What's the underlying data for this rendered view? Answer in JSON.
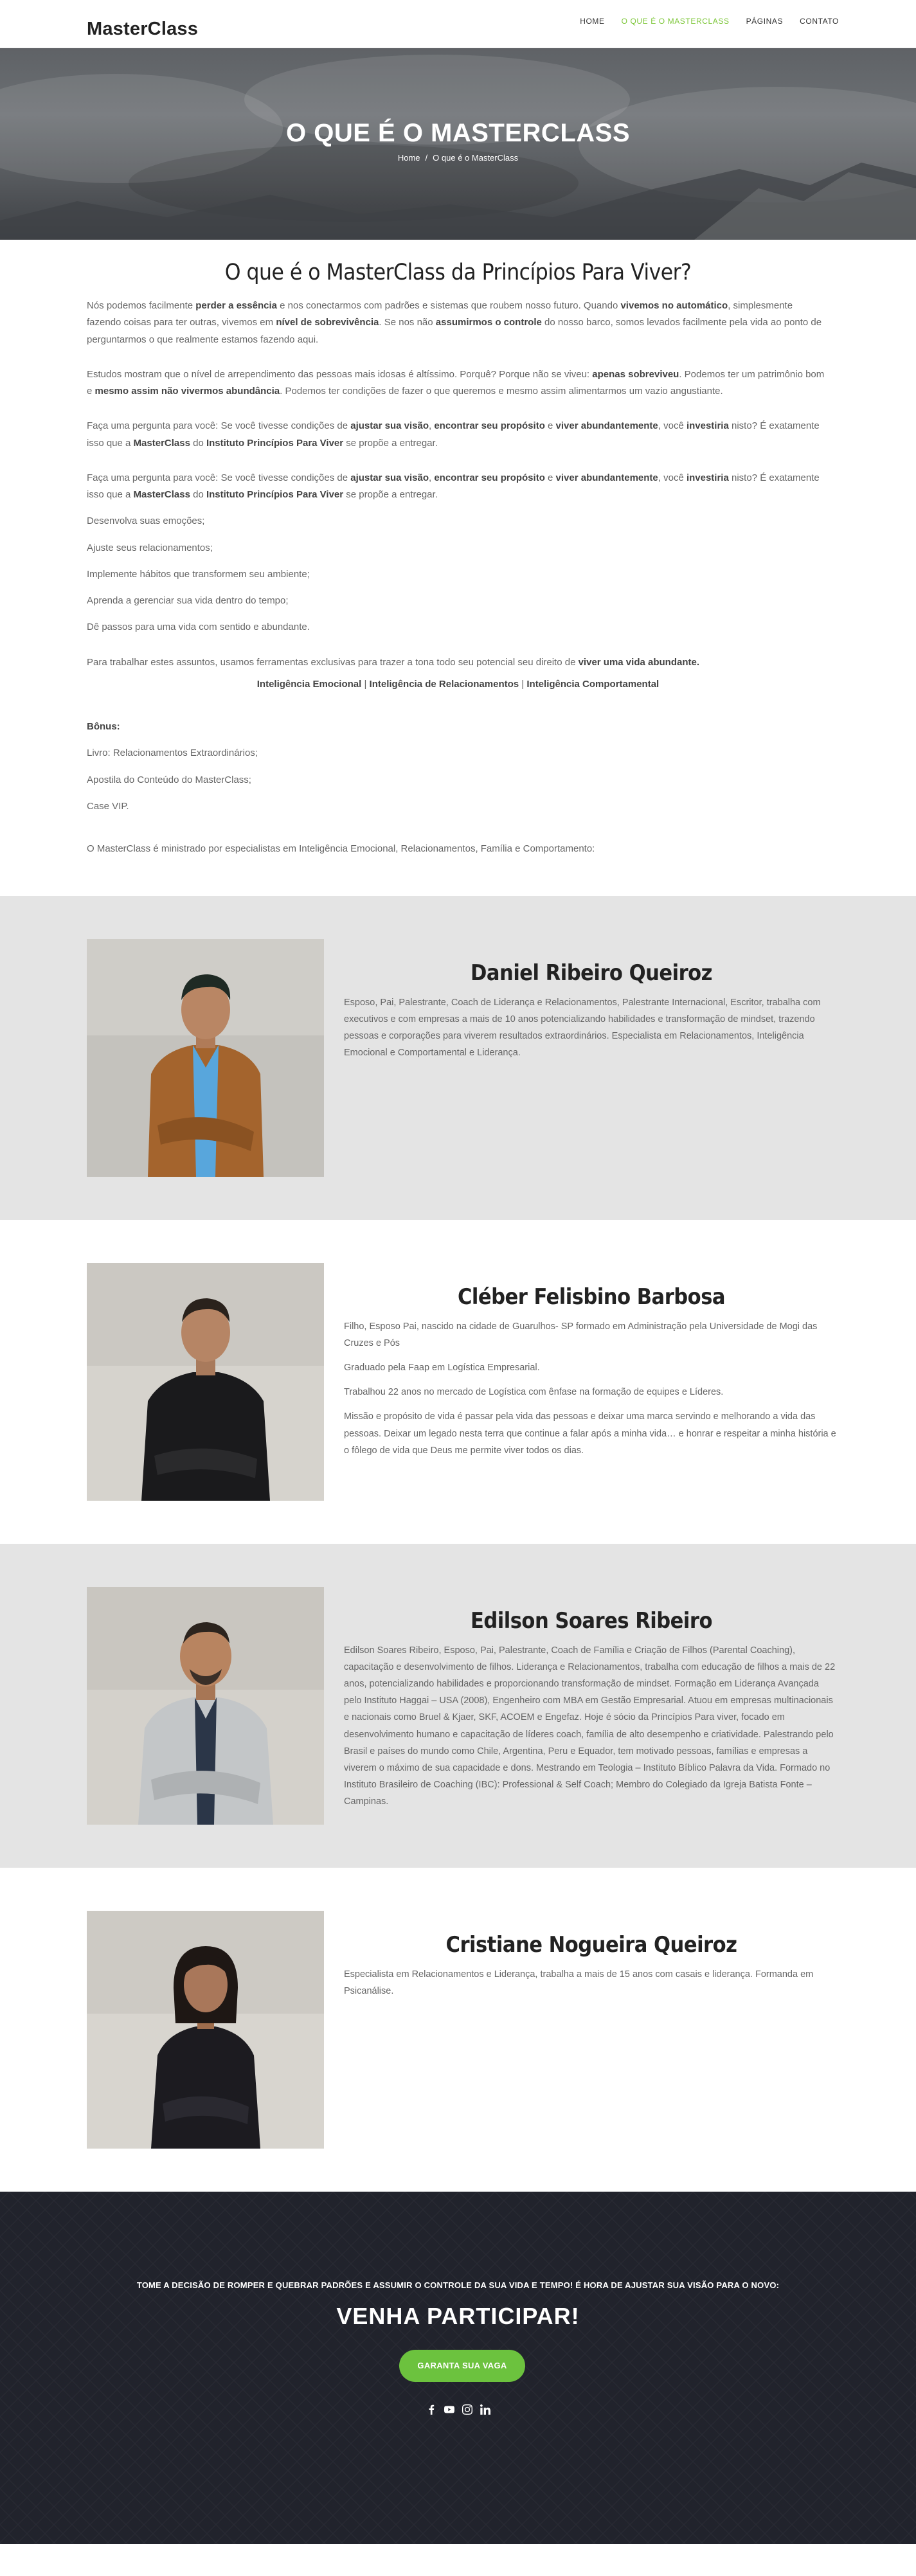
{
  "brand": {
    "logo": "MasterClass",
    "accent_color": "#7dc739",
    "button_color": "#6cc23e"
  },
  "nav": [
    {
      "label": "HOME",
      "active": false
    },
    {
      "label": "O QUE É O MASTERCLASS",
      "active": true
    },
    {
      "label": "PÁGINAS",
      "active": false
    },
    {
      "label": "CONTATO",
      "active": false
    }
  ],
  "hero": {
    "title": "O QUE É O MASTERCLASS",
    "breadcrumb_home": "Home",
    "breadcrumb_sep": "/",
    "breadcrumb_current": "O que é o MasterClass"
  },
  "intro": {
    "title": "O que é o MasterClass da Princípios Para Viver?",
    "p1": [
      {
        "t": "Nós podemos facilmente "
      },
      {
        "t": "perder a essência",
        "b": true
      },
      {
        "t": " e nos conectarmos com padrões e sistemas que roubem nosso futuro. Quando "
      },
      {
        "t": "vivemos no automático",
        "b": true
      },
      {
        "t": ", simplesmente fazendo coisas para ter outras, vivemos em "
      },
      {
        "t": "nível de sobrevivência",
        "b": true
      },
      {
        "t": ". Se nos não "
      },
      {
        "t": "assumirmos o controle",
        "b": true
      },
      {
        "t": " do nosso barco, somos levados facilmente pela vida ao ponto de perguntarmos o que realmente estamos fazendo aqui."
      }
    ],
    "p2": [
      {
        "t": "Estudos mostram que o nível de arrependimento das pessoas mais idosas é altíssimo. Porquê? Porque não se viveu: "
      },
      {
        "t": "apenas sobreviveu",
        "b": true
      },
      {
        "t": ". Podemos ter um patrimônio bom e "
      },
      {
        "t": "mesmo assim não vivermos abundância",
        "b": true
      },
      {
        "t": ". Podemos ter condições de fazer o que queremos e mesmo assim alimentarmos um vazio angustiante."
      }
    ],
    "p3": [
      {
        "t": "Faça uma pergunta para você: Se você tivesse condições de "
      },
      {
        "t": "ajustar sua visão",
        "b": true
      },
      {
        "t": ", "
      },
      {
        "t": "encontrar seu propósito",
        "b": true
      },
      {
        "t": " e "
      },
      {
        "t": "viver abundantemente",
        "b": true
      },
      {
        "t": ", você "
      },
      {
        "t": "investiria",
        "b": true
      },
      {
        "t": " nisto? É exatamente isso que a "
      },
      {
        "t": "MasterClass",
        "b": true
      },
      {
        "t": " do "
      },
      {
        "t": "Instituto Princípios Para Viver",
        "b": true
      },
      {
        "t": " se propõe a entregar."
      }
    ],
    "lines": [
      "Desenvolva suas emoções;",
      "Ajuste seus relacionamentos;",
      "Implemente hábitos que transformem seu ambiente;",
      "Aprenda a gerenciar sua vida dentro do tempo;",
      "Dê passos para uma vida com sentido e abundante."
    ],
    "p4": [
      {
        "t": "Para trabalhar estes assuntos, usamos ferramentas exclusivas para trazer a tona todo seu potencial seu direito de "
      },
      {
        "t": "viver uma vida abundante.",
        "b": true
      }
    ],
    "pillars": [
      {
        "t": "Inteligência Emocional",
        "b": true
      },
      {
        "t": " | "
      },
      {
        "t": "Inteligência de Relacionamentos",
        "b": true
      },
      {
        "t": " | "
      },
      {
        "t": "Inteligência Comportamental",
        "b": true
      }
    ],
    "bonus_title": "Bônus:",
    "bonus": [
      "Livro: Relacionamentos Extraordinários;",
      "Apostila do Conteúdo do MasterClass;",
      "Case VIP."
    ],
    "closing": "O MasterClass é ministrado por especialistas em Inteligência Emocional, Relacionamentos, Família e Comportamento:"
  },
  "team": [
    {
      "name": "Daniel Ribeiro Queiroz",
      "bio": [
        "Esposo, Pai, Palestrante, Coach de Liderança e Relacionamentos, Palestrante Internacional, Escritor, trabalha com executivos e com empresas a mais de 10 anos potencializando habilidades e  transformação de mindset, trazendo pessoas e corporações para viverem resultados extraordinários. Especialista em Relacionamentos, Inteligência Emocional e Comportamental e Liderança."
      ]
    },
    {
      "name": "Cléber Felisbino Barbosa",
      "bio": [
        "Filho, Esposo Pai, nascido na cidade de Guarulhos- SP formado em Administração pela Universidade de Mogi das Cruzes e Pós",
        "Graduado pela Faap em Logística Empresarial.",
        "Trabalhou 22 anos no mercado de Logística com ênfase na formação de equipes e Líderes.",
        "Missão e propósito de vida é passar pela vida das pessoas e deixar uma marca servindo e melhorando a vida das pessoas. Deixar um legado nesta terra que continue a falar após a minha vida… e honrar e respeitar a minha história e o fôlego de vida que Deus me permite viver todos os dias."
      ]
    },
    {
      "name": "Edilson Soares Ribeiro",
      "bio": [
        "Edilson Soares Ribeiro, Esposo, Pai, Palestrante, Coach de Família e Criação de Filhos (Parental Coaching), capacitação e desenvolvimento de filhos. Liderança e Relacionamentos, trabalha com educação de filhos a mais de 22 anos, potencializando habilidades e proporcionando transformação de mindset. Formação em Liderança Avançada pelo Instituto Haggai – USA (2008), Engenheiro com MBA em Gestão Empresarial. Atuou em empresas multinacionais e nacionais como Bruel & Kjaer, SKF, ACOEM e Engefaz. Hoje é sócio da Princípios Para viver, focado em desenvolvimento humano e capacitação de líderes coach, família de alto desempenho e criatividade. Palestrando pelo Brasil e países do mundo como Chile, Argentina, Peru e Equador, tem motivado pessoas, famílias e empresas a viverem o máximo de sua capacidade e dons. Mestrando em Teologia – Instituto Bíblico Palavra da Vida. Formado no Instituto Brasileiro de Coaching (IBC): Professional & Self Coach; Membro do Colegiado da Igreja Batista Fonte – Campinas."
      ]
    },
    {
      "name": "Cristiane Nogueira Queiroz",
      "bio": [
        "Especialista em Relacionamentos e Liderança, trabalha a mais de 15 anos com casais e liderança. Formanda em Psicanálise."
      ]
    }
  ],
  "cta": {
    "tagline": "Tome a decisão de romper e quebrar padrões e assumir o controle da sua vida e tempo! É hora de ajustar sua visão para o novo:",
    "title": "VENHA PARTICIPAR!",
    "button": "GARANTA SUA VAGA"
  },
  "social": [
    "facebook-icon",
    "youtube-icon",
    "instagram-icon",
    "linkedin-icon"
  ]
}
